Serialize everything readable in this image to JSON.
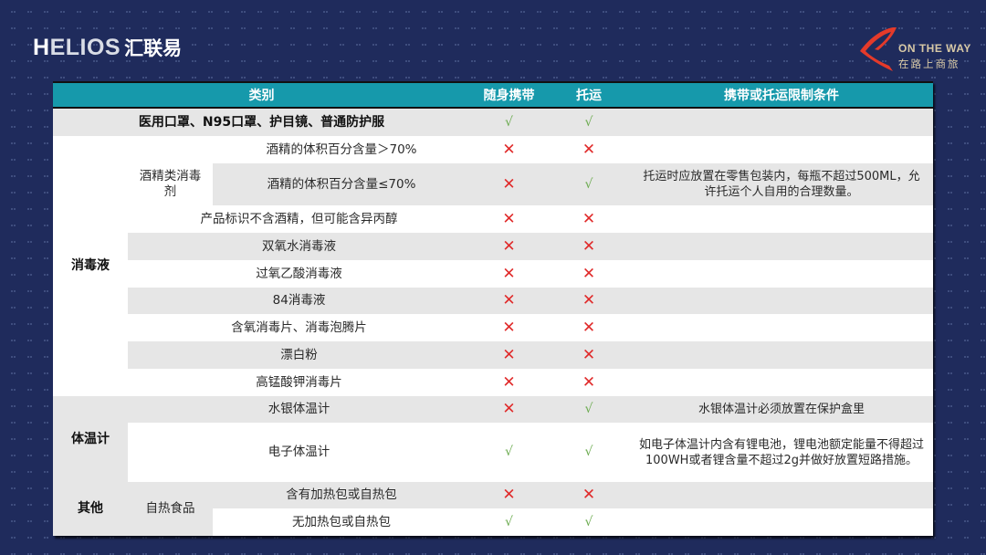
{
  "logo_left": {
    "mark": "H",
    "brand": "ELIOS",
    "name_cn": "汇联易"
  },
  "logo_right": {
    "tagline_en": "ON THE WAY",
    "tagline_cn": "在路上商旅",
    "accent_color": "#e43a2a"
  },
  "colors": {
    "header_bg": "#1699ab",
    "allowed": "#6bab4f",
    "forbidden": "#e02a2a",
    "page_bg": "#1f2b5c"
  },
  "symbols": {
    "allowed": "√",
    "forbidden": "✕"
  },
  "table": {
    "headers": {
      "category": "类别",
      "carry_on": "随身携带",
      "checked": "托运",
      "conditions": "携带或托运限制条件"
    },
    "groups": {
      "masks": "医用口罩、N95口罩、护目镜、普通防护服",
      "disinfectant": "消毒液",
      "alcohol_sub": "酒精类消毒剂",
      "thermometer": "体温计",
      "other": "其他",
      "self_heating_sub": "自热食品"
    },
    "rows": [
      {
        "item": "医用口罩、N95口罩、护目镜、普通防护服",
        "carry_on": "√",
        "checked": "√",
        "conditions": ""
      },
      {
        "item": "酒精的体积百分含量＞70%",
        "carry_on": "✕",
        "checked": "✕",
        "conditions": ""
      },
      {
        "item": "酒精的体积百分含量≤70%",
        "carry_on": "✕",
        "checked": "√",
        "conditions": "托运时应放置在零售包装内，每瓶不超过500ML，允许托运个人自用的合理数量。"
      },
      {
        "item": "产品标识不含酒精，但可能含异丙醇",
        "carry_on": "✕",
        "checked": "✕",
        "conditions": ""
      },
      {
        "item": "双氧水消毒液",
        "carry_on": "✕",
        "checked": "✕",
        "conditions": ""
      },
      {
        "item": "过氧乙酸消毒液",
        "carry_on": "✕",
        "checked": "✕",
        "conditions": ""
      },
      {
        "item": "84消毒液",
        "carry_on": "✕",
        "checked": "✕",
        "conditions": ""
      },
      {
        "item": "含氧消毒片、消毒泡腾片",
        "carry_on": "✕",
        "checked": "✕",
        "conditions": ""
      },
      {
        "item": "漂白粉",
        "carry_on": "✕",
        "checked": "✕",
        "conditions": ""
      },
      {
        "item": "高锰酸钾消毒片",
        "carry_on": "✕",
        "checked": "✕",
        "conditions": ""
      },
      {
        "item": "水银体温计",
        "carry_on": "✕",
        "checked": "√",
        "conditions": "水银体温计必须放置在保护盒里"
      },
      {
        "item": "电子体温计",
        "carry_on": "√",
        "checked": "√",
        "conditions": "如电子体温计内含有锂电池，锂电池额定能量不得超过100WH或者锂含量不超过2g并做好放置短路措施。"
      },
      {
        "item": "含有加热包或自热包",
        "carry_on": "✕",
        "checked": "✕",
        "conditions": ""
      },
      {
        "item": "无加热包或自热包",
        "carry_on": "√",
        "checked": "√",
        "conditions": ""
      }
    ]
  }
}
